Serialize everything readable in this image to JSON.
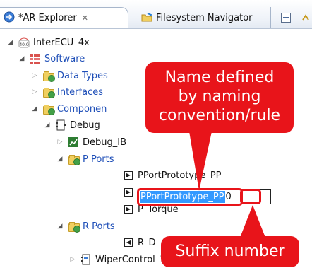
{
  "tabs": [
    {
      "label": "*AR Explorer",
      "close": "✕",
      "icon": "ar-explorer-icon",
      "active": true
    },
    {
      "label": "Filesystem Navigator",
      "icon": "filesystem-navigator-icon",
      "active": false
    }
  ],
  "toolbar": {
    "collapse_icon": "collapse-all-icon",
    "link_icon": "link-with-editor-icon"
  },
  "tree": {
    "root": {
      "label": "InterECU_4x",
      "icon_text": "40.0"
    },
    "software": "Software",
    "data_types": "Data Types",
    "interfaces": "Interfaces",
    "components": "Componen",
    "debug": "Debug",
    "debug_ib": "Debug_IB",
    "p_ports": "P Ports",
    "pport_1": "PPortPrototype_PP",
    "pport_edit_selected": "PPortPrototype_PP",
    "pport_edit_suffix": "0",
    "p_torque": "P_Torque",
    "r_ports": "R Ports",
    "r_item": "R_D",
    "wiper": "WiperControl_100us"
  },
  "callouts": {
    "name_line1": "Name defined",
    "name_line2": "by naming",
    "name_line3": "convention/rule",
    "suffix": "Suffix number"
  },
  "colors": {
    "accent": "#e8141a",
    "selection": "#3399ff",
    "tree_blue": "#1f4fb8"
  }
}
